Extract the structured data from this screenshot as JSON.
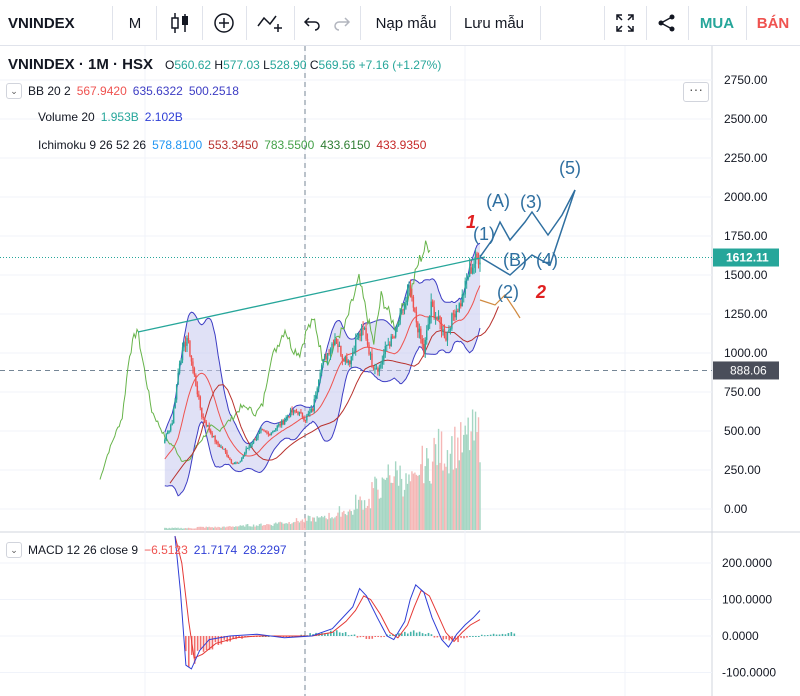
{
  "toolbar": {
    "symbol": "VNINDEX",
    "interval": "M",
    "load_template": "Nạp mẫu",
    "save_template": "Lưu mẫu",
    "buy": "MUA",
    "sell": "BÁN"
  },
  "legend": {
    "symbol_line": "VNINDEX · 1M · HSX",
    "o_label": "O",
    "o_value": "560.62",
    "h_label": "H",
    "h_value": "577.03",
    "l_label": "L",
    "l_value": "528.90",
    "c_label": "C",
    "c_value": "569.56",
    "change": "+7.16 (+1.27%)",
    "bb": {
      "name": "BB 20 2",
      "v1": "567.9420",
      "v2": "635.6322",
      "v3": "500.2518"
    },
    "volume": {
      "name": "Volume 20",
      "v1": "1.953B",
      "v2": "2.102B"
    },
    "ichimoku": {
      "name": "Ichimoku 9 26 52 26",
      "v1": "578.8100",
      "v2": "553.3450",
      "v3": "783.5500",
      "v4": "433.6150",
      "v5": "433.9350"
    },
    "macd": {
      "name": "MACD 12 26 close 9",
      "v1": "−6.5123",
      "v2": "21.7174",
      "v3": "28.2297"
    }
  },
  "colors": {
    "up": "#26a69a",
    "down": "#ef5350",
    "bb_band": "#3d3dc4",
    "bb_fill": "#c7c9ef",
    "ichimoku_lagging": "#67b44a",
    "ichimoku_base": "#b8322e",
    "macd_line": "#2f3fd6",
    "signal_line": "#e53935",
    "annotation": "#2f6fa0",
    "trendline": "#26a69a",
    "price_label_bg": "#26a69a",
    "cross_label_bg": "#4a4e5a"
  },
  "chart_data": [
    {
      "type": "candlestick",
      "title": "VNINDEX · 1M · HSX",
      "ylim": [
        -100,
        2900
      ],
      "y_ticks": [
        "2750.00",
        "2500.00",
        "2250.00",
        "2000.00",
        "1750.00",
        "1500.00",
        "1250.00",
        "1000.00",
        "750.00",
        "500.00",
        "250.00",
        "0.00"
      ],
      "last_price": "1612.11",
      "crosshair_price": "888.06",
      "approx_close_path": [
        [
          0,
          180
        ],
        [
          5,
          330
        ],
        [
          10,
          450
        ],
        [
          15,
          560
        ],
        [
          20,
          950
        ],
        [
          25,
          1100
        ],
        [
          30,
          850
        ],
        [
          35,
          600
        ],
        [
          40,
          510
        ],
        [
          45,
          420
        ],
        [
          50,
          380
        ],
        [
          55,
          300
        ],
        [
          60,
          290
        ],
        [
          65,
          380
        ],
        [
          70,
          440
        ],
        [
          75,
          500
        ],
        [
          80,
          480
        ],
        [
          85,
          520
        ],
        [
          90,
          560
        ],
        [
          95,
          620
        ],
        [
          100,
          620
        ],
        [
          105,
          580
        ],
        [
          110,
          640
        ],
        [
          115,
          900
        ],
        [
          120,
          1000
        ],
        [
          125,
          1100
        ],
        [
          130,
          980
        ],
        [
          135,
          950
        ],
        [
          140,
          1100
        ],
        [
          145,
          1150
        ],
        [
          150,
          930
        ],
        [
          155,
          900
        ],
        [
          160,
          1050
        ],
        [
          165,
          1100
        ],
        [
          170,
          1250
        ],
        [
          175,
          1400
        ],
        [
          180,
          1200
        ],
        [
          185,
          1010
        ],
        [
          190,
          1300
        ],
        [
          195,
          1200
        ],
        [
          200,
          1100
        ],
        [
          205,
          1250
        ],
        [
          210,
          1320
        ],
        [
          215,
          1500
        ],
        [
          220,
          1600
        ],
        [
          223,
          1612
        ]
      ],
      "wave_labels": [
        "(1)",
        "(2)",
        "(A)",
        "(B)",
        "(3)",
        "(4)",
        "(5)"
      ],
      "handwritten_marks": [
        "1",
        "2"
      ]
    },
    {
      "type": "bar",
      "name": "Volume 20",
      "values_rel": [
        0.02,
        0.02,
        0.03,
        0.03,
        0.04,
        0.05,
        0.06,
        0.08,
        0.1,
        0.12,
        0.15,
        0.2,
        0.3,
        0.45,
        0.6,
        0.5,
        0.7,
        0.85,
        0.9,
        1.0
      ]
    },
    {
      "type": "line",
      "name": "MACD 12 26 close 9",
      "ylim": [
        -130,
        300
      ],
      "y_ticks": [
        "200.0000",
        "100.0000",
        "0.0000",
        "-100.0000"
      ],
      "macd_path": [
        [
          0,
          300
        ],
        [
          4,
          120
        ],
        [
          8,
          -80
        ],
        [
          12,
          -90
        ],
        [
          18,
          -40
        ],
        [
          25,
          -10
        ],
        [
          40,
          0
        ],
        [
          60,
          5
        ],
        [
          80,
          -5
        ],
        [
          100,
          0
        ],
        [
          115,
          20
        ],
        [
          125,
          60
        ],
        [
          130,
          80
        ],
        [
          135,
          130
        ],
        [
          140,
          110
        ],
        [
          148,
          50
        ],
        [
          155,
          0
        ],
        [
          160,
          -10
        ],
        [
          168,
          40
        ],
        [
          172,
          100
        ],
        [
          176,
          140
        ],
        [
          182,
          120
        ],
        [
          188,
          50
        ],
        [
          195,
          -10
        ],
        [
          200,
          -30
        ],
        [
          206,
          5
        ],
        [
          212,
          30
        ],
        [
          218,
          50
        ],
        [
          223,
          70
        ]
      ],
      "signal_path": [
        [
          0,
          300
        ],
        [
          5,
          200
        ],
        [
          10,
          40
        ],
        [
          14,
          -60
        ],
        [
          20,
          -50
        ],
        [
          30,
          -20
        ],
        [
          45,
          -5
        ],
        [
          60,
          0
        ],
        [
          80,
          0
        ],
        [
          100,
          0
        ],
        [
          115,
          10
        ],
        [
          125,
          40
        ],
        [
          132,
          70
        ],
        [
          138,
          110
        ],
        [
          143,
          100
        ],
        [
          150,
          60
        ],
        [
          157,
          10
        ],
        [
          163,
          -5
        ],
        [
          170,
          30
        ],
        [
          175,
          80
        ],
        [
          180,
          125
        ],
        [
          186,
          110
        ],
        [
          192,
          60
        ],
        [
          198,
          10
        ],
        [
          204,
          -15
        ],
        [
          210,
          10
        ],
        [
          216,
          30
        ],
        [
          223,
          45
        ]
      ],
      "histogram": [
        -200,
        -180,
        -100,
        -60,
        -40,
        -20,
        -10,
        -5,
        0,
        5,
        -5,
        0,
        10,
        20,
        30,
        40,
        25,
        10,
        -10,
        -20,
        -10,
        10,
        20,
        30,
        40,
        20,
        -10,
        -30,
        -40,
        -20,
        0,
        10,
        15,
        20,
        25
      ]
    }
  ]
}
